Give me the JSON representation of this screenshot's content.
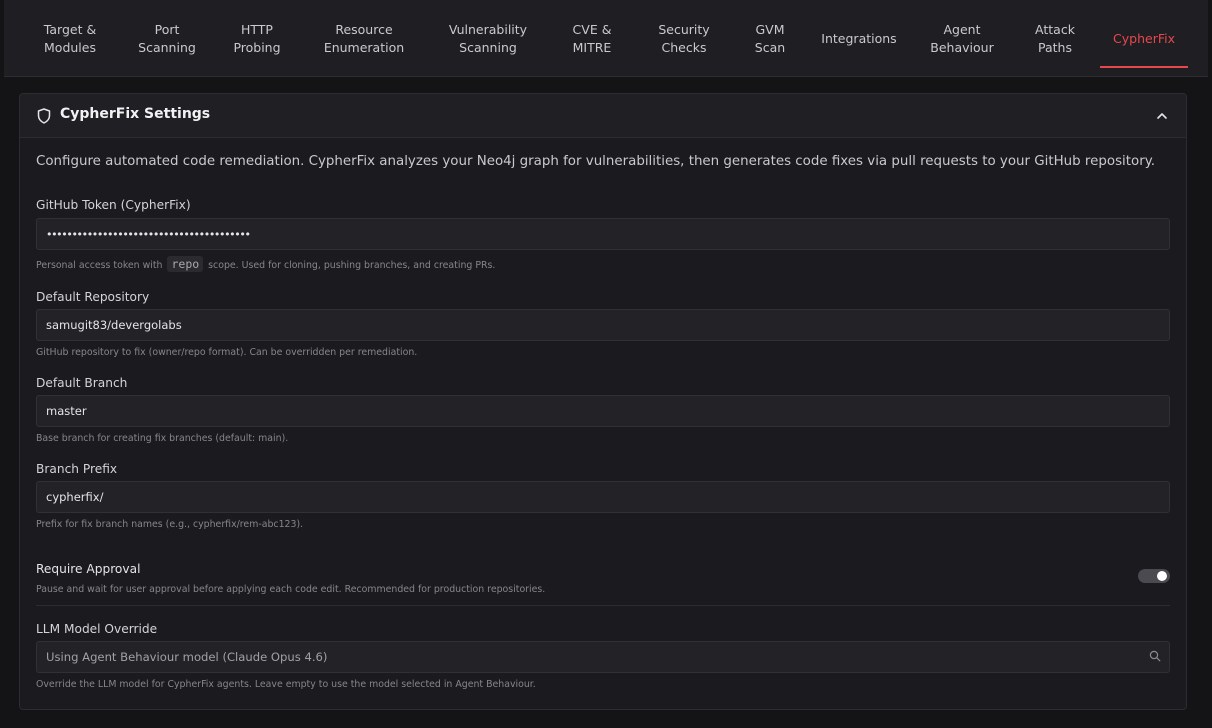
{
  "tabs": [
    {
      "label": "Target &\nModules",
      "active": false
    },
    {
      "label": "Port\nScanning",
      "active": false
    },
    {
      "label": "HTTP\nProbing",
      "active": false
    },
    {
      "label": "Resource\nEnumeration",
      "active": false
    },
    {
      "label": "Vulnerability\nScanning",
      "active": false
    },
    {
      "label": "CVE &\nMITRE",
      "active": false
    },
    {
      "label": "Security\nChecks",
      "active": false
    },
    {
      "label": "GVM\nScan",
      "active": false
    },
    {
      "label": "Integrations",
      "active": false
    },
    {
      "label": "Agent\nBehaviour",
      "active": false
    },
    {
      "label": "Attack\nPaths",
      "active": false
    },
    {
      "label": "CypherFix",
      "active": true
    }
  ],
  "card": {
    "title": "CypherFix Settings",
    "description": "Configure automated code remediation. CypherFix analyzes your Neo4j graph for vulnerabilities, then generates code fixes via pull requests to your GitHub repository."
  },
  "fields": {
    "github_token": {
      "label": "GitHub Token (CypherFix)",
      "value": "••••••••••••••••••••••••••••••••••••••••",
      "help_before": "Personal access token with",
      "help_code": "repo",
      "help_after": "scope. Used for cloning, pushing branches, and creating PRs."
    },
    "default_repository": {
      "label": "Default Repository",
      "value": "samugit83/devergolabs",
      "help": "GitHub repository to fix (owner/repo format). Can be overridden per remediation."
    },
    "default_branch": {
      "label": "Default Branch",
      "value": "master",
      "help": "Base branch for creating fix branches (default: main)."
    },
    "branch_prefix": {
      "label": "Branch Prefix",
      "value": "cypherfix/",
      "help": "Prefix for fix branch names (e.g., cypherfix/rem-abc123)."
    },
    "require_approval": {
      "label": "Require Approval",
      "help": "Pause and wait for user approval before applying each code edit. Recommended for production repositories.",
      "enabled": true
    },
    "llm_model_override": {
      "label": "LLM Model Override",
      "placeholder": "Using Agent Behaviour model (Claude Opus 4.6)",
      "help": "Override the LLM model for CypherFix agents. Leave empty to use the model selected in Agent Behaviour."
    }
  },
  "colors": {
    "accent": "#e5484d",
    "background": "#141417",
    "card": "#1b1b1f"
  }
}
